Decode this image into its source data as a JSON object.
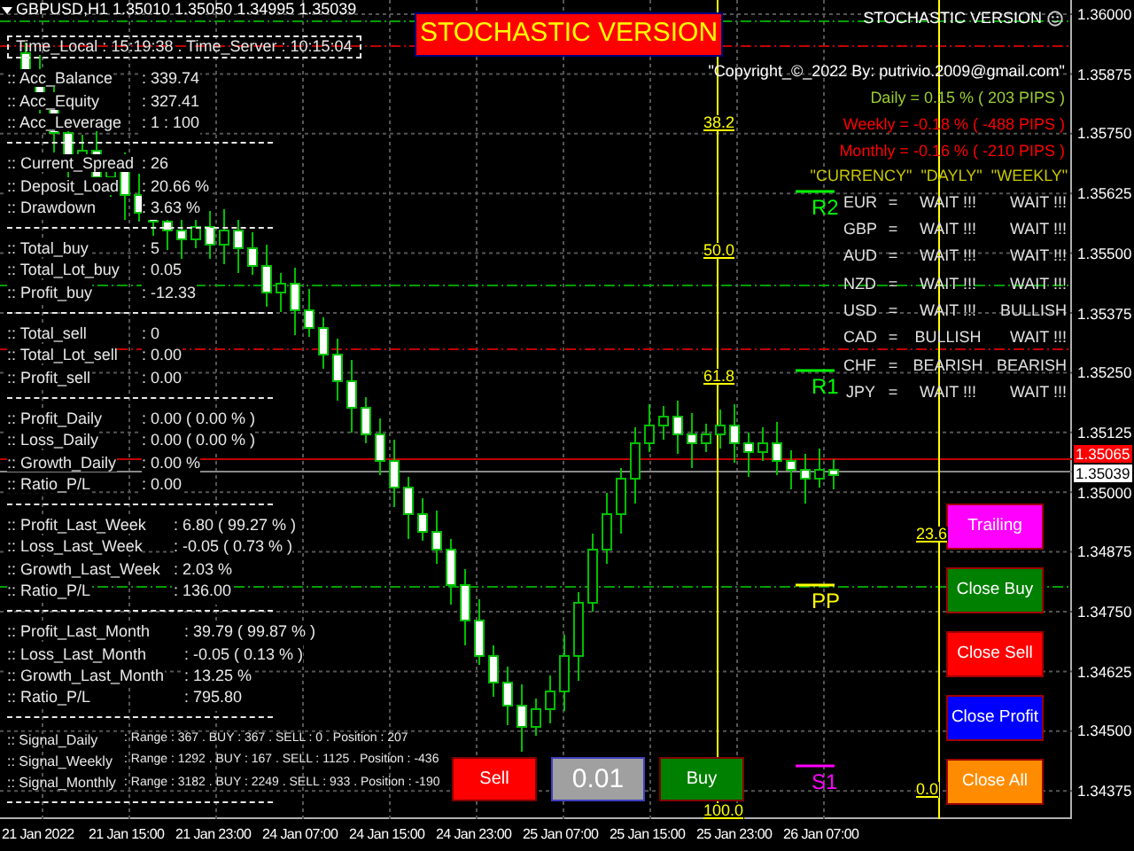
{
  "chart_header": {
    "title": "GBPUSD,H1 1.35010 1.35050 1.34995 1.35039"
  },
  "banner": {
    "title": "STOCHASTIC VERSION"
  },
  "version_label": "STOCHASTIC VERSION",
  "info_panel": {
    "time_line": "Time_Local : 15:19:38 . Time_Server : 10:15:04",
    "sections": [
      [
        {
          "label": ":: Acc_Balance",
          "value": ": 339.74"
        },
        {
          "label": ":: Acc_Equity",
          "value": ": 327.41"
        },
        {
          "label": ":: Acc_Leverage",
          "value": ": 1 : 100"
        }
      ],
      [
        {
          "label": ":: Current_Spread",
          "value": ": 26"
        },
        {
          "label": ":: Deposit_Load",
          "value": ": 20.66 %"
        },
        {
          "label": ":: Drawdown",
          "value": ": 3.63 %"
        }
      ],
      [
        {
          "label": ":: Total_buy",
          "value": ": 5"
        },
        {
          "label": ":: Total_Lot_buy",
          "value": ": 0.05"
        },
        {
          "label": ":: Profit_buy",
          "value": ": -12.33"
        }
      ],
      [
        {
          "label": ":: Total_sell",
          "value": ": 0"
        },
        {
          "label": ":: Total_Lot_sell",
          "value": ": 0.00"
        },
        {
          "label": ":: Profit_sell",
          "value": ": 0.00"
        }
      ],
      [
        {
          "label": ":: Profit_Daily",
          "value": ": 0.00 ( 0.00 % )"
        },
        {
          "label": ":: Loss_Daily",
          "value": ": 0.00 ( 0.00 % )"
        },
        {
          "label": ":: Growth_Daily",
          "value": ": 0.00 %"
        },
        {
          "label": ":: Ratio_P/L",
          "value": ": 0.00"
        }
      ],
      [
        {
          "label": ":: Profit_Last_Week",
          "value": ": 6.80 ( 99.27 % )"
        },
        {
          "label": ":: Loss_Last_Week",
          "value": ": -0.05 ( 0.73 % )"
        },
        {
          "label": ":: Growth_Last_Week",
          "value": ": 2.03 %"
        },
        {
          "label": ":: Ratio_P/L",
          "value": ": 136.00"
        }
      ],
      [
        {
          "label": ":: Profit_Last_Month",
          "value": ": 39.79 ( 99.87 % )"
        },
        {
          "label": ":: Loss_Last_Month",
          "value": ": -0.05 ( 0.13 % )"
        },
        {
          "label": ":: Growth_Last_Month",
          "value": ": 13.25 %"
        },
        {
          "label": ":: Ratio_P/L",
          "value": ": 795.80"
        }
      ],
      [
        {
          "label": ":: Signal_Daily",
          "value": ": Range : 367 . BUY : 367 . SELL : 0 . Position : 207"
        },
        {
          "label": ":: Signal_Weekly",
          "value": ": Range : 1292 . BUY : 167 . SELL : 1125 . Position : -436"
        },
        {
          "label": ":: Signal_Monthly",
          "value": ": Range : 3182 . BUY : 2249 . SELL : 933 . Position : -190"
        }
      ]
    ]
  },
  "copyright": "\"Copyright_©_2022 By: putrivio.2009@gmail.com\"",
  "performance": [
    {
      "text": "Daily = 0.15 % ( 203 PIPS )",
      "color": "#9acd32"
    },
    {
      "text": "Weekly = -0.18 % ( -488 PIPS )",
      "color": "#ff0000"
    },
    {
      "text": "Monthly = -0.16 % ( -210 PIPS )",
      "color": "#ff0000"
    }
  ],
  "currency_table": {
    "columns": [
      "\"CURRENCY\"",
      "\"DAYLY\"",
      "\"WEEKLY\""
    ],
    "rows": [
      {
        "currency": "EUR",
        "sign": "=",
        "daily": "WAIT !!!",
        "weekly": "WAIT !!!"
      },
      {
        "currency": "GBP",
        "sign": "=",
        "daily": "WAIT !!!",
        "weekly": "WAIT !!!"
      },
      {
        "currency": "AUD",
        "sign": "=",
        "daily": "WAIT !!!",
        "weekly": "WAIT !!!"
      },
      {
        "currency": "NZD",
        "sign": "=",
        "daily": "WAIT !!!",
        "weekly": "WAIT !!!"
      },
      {
        "currency": "USD",
        "sign": "=",
        "daily": "WAIT !!!",
        "weekly": "BULLISH"
      },
      {
        "currency": "CAD",
        "sign": "=",
        "daily": "BULLISH",
        "weekly": "WAIT !!!"
      },
      {
        "currency": "CHF",
        "sign": "=",
        "daily": "BEARISH",
        "weekly": "BEARISH"
      },
      {
        "currency": "JPY",
        "sign": "=",
        "daily": "WAIT !!!",
        "weekly": "WAIT !!!"
      }
    ]
  },
  "fib_lines": [
    {
      "labels": [
        "38.2",
        "50.0",
        "61.8",
        "100.0"
      ]
    },
    {
      "labels": [
        "23.6",
        "0.0"
      ]
    }
  ],
  "pivots": [
    {
      "label": "R2",
      "color": "#00ff00"
    },
    {
      "label": "R1",
      "color": "#00ff00"
    },
    {
      "label": "PP",
      "color": "#ffff00"
    },
    {
      "label": "S1",
      "color": "#ff00ff"
    }
  ],
  "trade_buttons": [
    {
      "label": "Sell",
      "kind": "sell"
    },
    {
      "label": "0.01",
      "kind": "lot"
    },
    {
      "label": "Buy",
      "kind": "buy"
    }
  ],
  "action_buttons": [
    {
      "label": "Trailing",
      "color": "#ff00ff"
    },
    {
      "label": "Close Buy",
      "color": "#008000"
    },
    {
      "label": "Close Sell",
      "color": "#ff0000"
    },
    {
      "label": "Close Profit",
      "color": "#0000ff"
    },
    {
      "label": "Close All",
      "color": "#ff8c00"
    }
  ],
  "price_axis": {
    "ticks": [
      "1.36000",
      "1.35875",
      "1.35750",
      "1.35625",
      "1.35500",
      "1.35375",
      "1.35250",
      "1.35125",
      "1.35000",
      "1.34875",
      "1.34750",
      "1.34625",
      "1.34500",
      "1.34375"
    ],
    "ask": "1.35065",
    "bid": "1.35039"
  },
  "time_axis": [
    "21 Jan 2022",
    "21 Jan 15:00",
    "21 Jan 23:00",
    "24 Jan 07:00",
    "24 Jan 15:00",
    "24 Jan 23:00",
    "25 Jan 07:00",
    "25 Jan 15:00",
    "25 Jan 23:00",
    "26 Jan 07:00"
  ]
}
